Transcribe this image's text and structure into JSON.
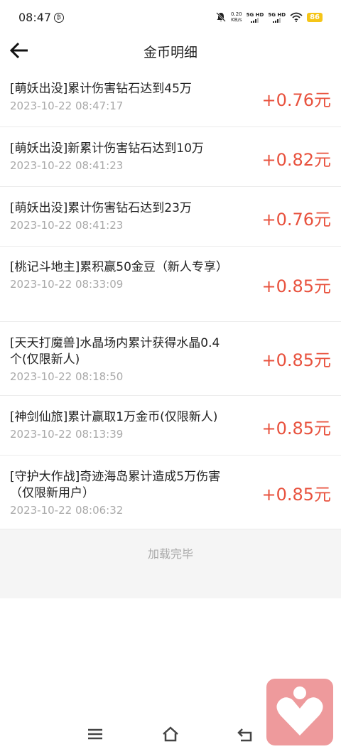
{
  "status": {
    "time": "08:47",
    "circle_glyph": "₿",
    "speed_value": "0.20",
    "speed_unit": "KB/s",
    "signal_1": "5G HD",
    "signal_2": "5G HD",
    "battery": "86"
  },
  "header": {
    "title": "金币明细",
    "back_icon": "arrow-left-icon"
  },
  "records": [
    {
      "title": "[萌妖出没]累计伤害钻石达到45万",
      "time": "2023-10-22 08:47:17",
      "amount": "+0.76元"
    },
    {
      "title": "[萌妖出没]新累计伤害钻石达到10万",
      "time": "2023-10-22 08:41:23",
      "amount": "+0.82元"
    },
    {
      "title": "[萌妖出没]累计伤害钻石达到23万",
      "time": "2023-10-22 08:41:23",
      "amount": "+0.76元"
    },
    {
      "title": "[桃记斗地主]累积赢50金豆（新人专享）",
      "time": "2023-10-22 08:33:09",
      "amount": "+0.85元"
    },
    {
      "title": "[天天打魔兽]水晶场内累计获得水晶0.4个(仅限新人)",
      "time": "2023-10-22 08:18:50",
      "amount": "+0.85元"
    },
    {
      "title": "[神剑仙旅]累计赢取1万金币(仅限新人)",
      "time": "2023-10-22 08:13:39",
      "amount": "+0.85元"
    },
    {
      "title": "[守护大作战]奇迹海岛累计造成5万伤害（仅限新用户）",
      "time": "2023-10-22 08:06:32",
      "amount": "+0.85元"
    }
  ],
  "footer": {
    "text": "加载完毕"
  },
  "colors": {
    "amount": "#e8523e",
    "battery": "#f5c518",
    "widget": "#ee9a9c"
  },
  "icons": {
    "widget": "heart-person-icon",
    "menu": "menu-icon",
    "home": "home-icon",
    "back": "back-return-icon"
  }
}
